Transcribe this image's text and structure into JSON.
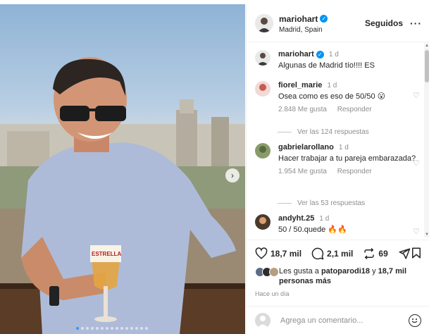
{
  "post": {
    "username": "mariohart",
    "location": "Madrid, Spain",
    "follow_label": "Seguidos",
    "more_label": "···"
  },
  "media": {
    "next_label": "›",
    "carousel_dots": 15,
    "active_dot": 0,
    "sign_text": "ESTRELLA"
  },
  "caption": {
    "username": "mariohart",
    "time": "1 d",
    "text": "Algunas de Madrid tío!!!! ES"
  },
  "comments": [
    {
      "username": "fiorel_marie",
      "time": "1 d",
      "text": "Osea como es eso de 50/50 😮",
      "likes": "2.848 Me gusta",
      "reply_label": "Responder",
      "replies": "Ver las 124 respuestas"
    },
    {
      "username": "gabrielarollano",
      "time": "1 d",
      "text": "Hacer trabajar a tu pareja embarazada?",
      "likes": "1.954 Me gusta",
      "reply_label": "Responder",
      "replies": "Ver las 53 respuestas"
    },
    {
      "username": "andyht.25",
      "time": "1 d",
      "text": "50 / 50.quede 🔥🔥"
    }
  ],
  "actions": {
    "likes_count": "18,7 mil",
    "comments_count": "2,1 mil",
    "reposts_count": "69"
  },
  "likes_summary": {
    "prefix": "Les gusta a ",
    "user": "patoparodi18",
    "middle": " y ",
    "count": "18,7 mil",
    "suffix": "personas más"
  },
  "posted_time": "Hace un día",
  "add_comment": {
    "placeholder": "Agrega un comentario..."
  },
  "colors": {
    "verified": "#0095f6",
    "link_blue": "#0095f6",
    "muted": "#8e8e8e"
  },
  "icons": [
    "verified-icon",
    "heart-icon",
    "comment-icon",
    "repost-icon",
    "share-icon",
    "bookmark-icon",
    "emoji-icon",
    "chevron-right-icon"
  ]
}
